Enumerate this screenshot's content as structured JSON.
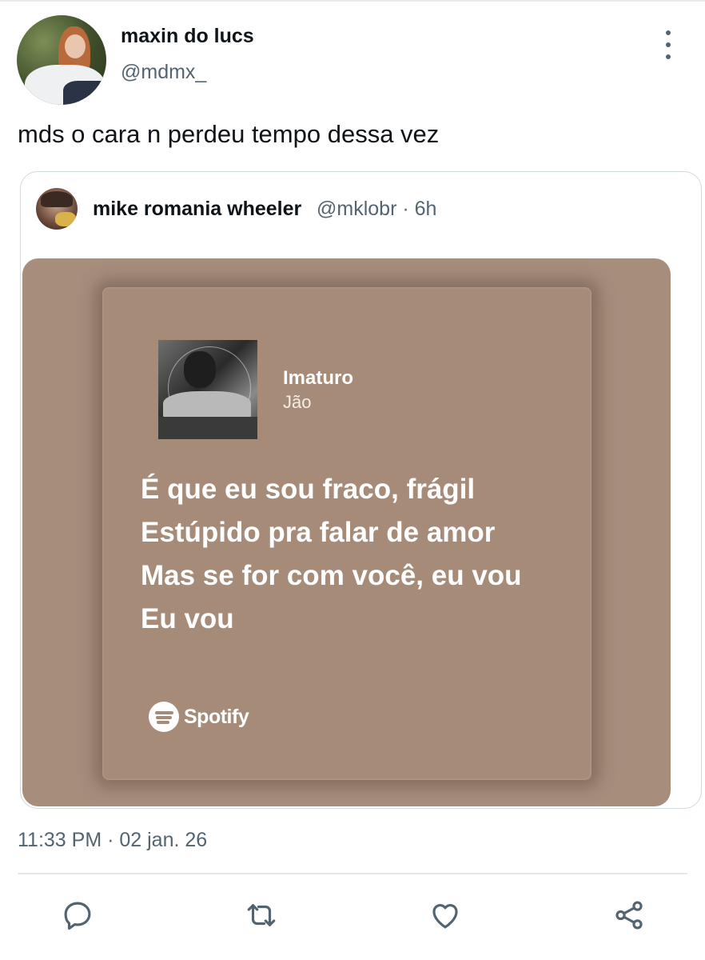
{
  "tweet": {
    "author": {
      "name": "maxin do lucs",
      "handle": "@mdmx_"
    },
    "text": "mds o cara n perdeu tempo dessa vez",
    "timestamp": "11:33 PM · 02 jan. 26"
  },
  "quoted": {
    "author": {
      "name": "mike romania wheeler",
      "handle_time": "@mklobr · 6h"
    },
    "card": {
      "song": "Imaturo",
      "artist": "Jão",
      "lyrics": [
        "É que eu sou fraco, frágil",
        "Estúpido pra falar de amor",
        "Mas se for com você, eu vou",
        "Eu vou"
      ],
      "brand": "Spotify"
    }
  },
  "actions": [
    "reply-icon",
    "retweet-icon",
    "like-icon",
    "share-icon"
  ],
  "colors": {
    "card_background": "#a68d7c",
    "secondary_text": "#536471",
    "icon": "#536471"
  }
}
